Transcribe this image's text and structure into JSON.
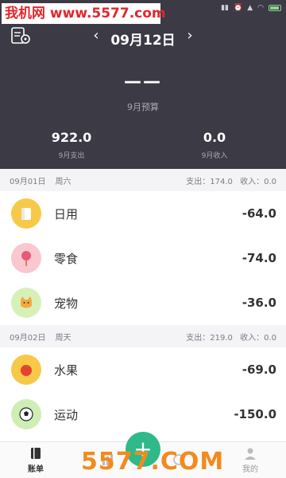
{
  "watermark": {
    "top_text": "我机网 www.5577.com",
    "bottom_text": "5577.COM"
  },
  "header": {
    "date": "09月12日",
    "budget_value": "——",
    "budget_label": "9月预算",
    "expense_value": "922.0",
    "expense_label": "9月支出",
    "income_value": "0.0",
    "income_label": "9月收入"
  },
  "groups": [
    {
      "date": "09月01日",
      "weekday": "周六",
      "expense_summary": "支出：174.0",
      "income_summary": "收入：0.0",
      "items": [
        {
          "name": "日用",
          "amount": "-64.0",
          "icon": "daily-use-icon",
          "color": "#f7c948"
        },
        {
          "name": "零食",
          "amount": "-74.0",
          "icon": "lollipop-icon",
          "color": "#f9c7cf"
        },
        {
          "name": "宠物",
          "amount": "-36.0",
          "icon": "pet-cat-icon",
          "color": "#d6f1b8"
        }
      ]
    },
    {
      "date": "09月02日",
      "weekday": "周天",
      "expense_summary": "支出：219.0",
      "income_summary": "收入：0.0",
      "items": [
        {
          "name": "水果",
          "amount": "-69.0",
          "icon": "tomato-icon",
          "color": "#f7c948"
        },
        {
          "name": "运动",
          "amount": "-150.0",
          "icon": "soccer-ball-icon",
          "color": "#cfeeb5"
        }
      ]
    }
  ],
  "tabs": [
    {
      "label": "账单",
      "icon": "bill-icon",
      "active": true
    },
    {
      "label": "",
      "icon": "chart-icon",
      "active": false
    },
    {
      "label": "",
      "icon": "discover-icon",
      "active": false
    },
    {
      "label": "我的",
      "icon": "user-icon",
      "active": false
    }
  ],
  "fab_label": "+"
}
